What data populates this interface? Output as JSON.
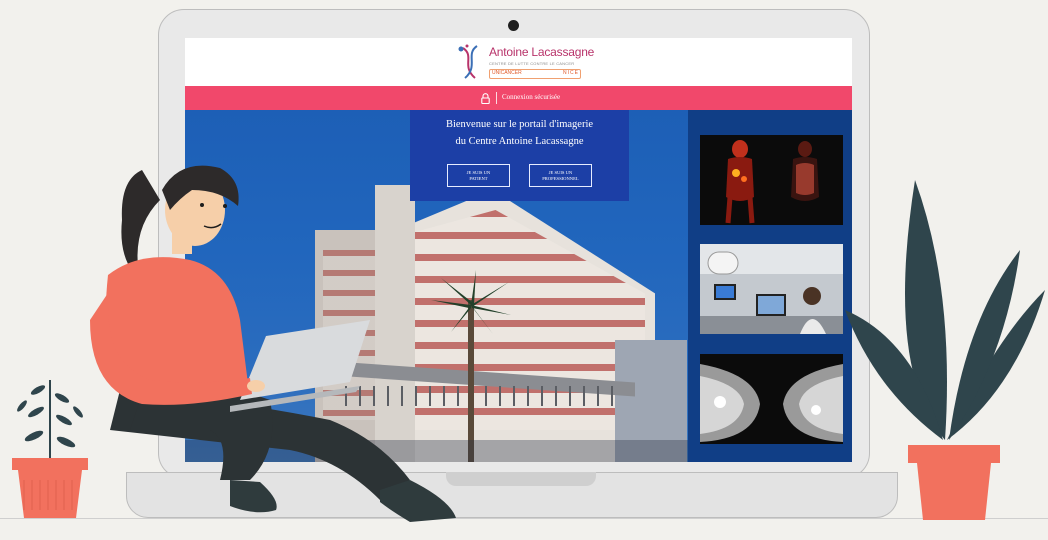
{
  "site": {
    "logo": {
      "title": "Antoine Lacassagne",
      "subtitle": "CENTRE DE LUTTE CONTRE LE CANCER",
      "network": "UNICANCER",
      "city": "NICE"
    },
    "secure_bar": {
      "text": "Connexion sécurisée",
      "color": "#f1486b"
    },
    "welcome": {
      "line1": "Bienvenue sur le portail d'imagerie",
      "line2": "du Centre Antoine Lacassagne",
      "buttons": {
        "patient": [
          "JE SUIS UN",
          "PATIENT"
        ],
        "professional": [
          "JE SUIS UN",
          "PROFESSIONNEL"
        ]
      },
      "panel_color": "#1c3fa6"
    },
    "side_images": [
      "pet-scan-image",
      "radiology-room-image",
      "mammography-image"
    ]
  },
  "illustration": {
    "icons": [
      "lock-icon",
      "person-with-laptop",
      "potted-plant-left",
      "potted-plant-right"
    ],
    "colors": {
      "background": "#f2f1ed",
      "sweater": "#f2715e",
      "pot": "#f2715e",
      "leaves": "#2f454c"
    }
  }
}
